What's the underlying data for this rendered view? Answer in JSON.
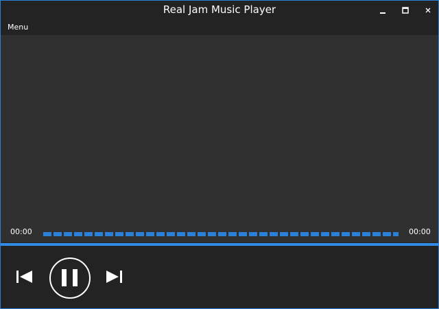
{
  "window": {
    "title": "Real Jam Music Player",
    "accent_color": "#2b80d9"
  },
  "titlebar_buttons": {
    "minimize": "minimize-icon",
    "maximize": "maximize-icon",
    "close": "close-icon"
  },
  "menubar": {
    "menu_label": "Menu"
  },
  "player": {
    "elapsed_time": "00:00",
    "total_time": "00:00",
    "progress": 0,
    "state": "playing"
  },
  "controls": {
    "previous": "skip-previous-icon",
    "play_pause": "pause-icon",
    "next": "skip-next-icon"
  }
}
